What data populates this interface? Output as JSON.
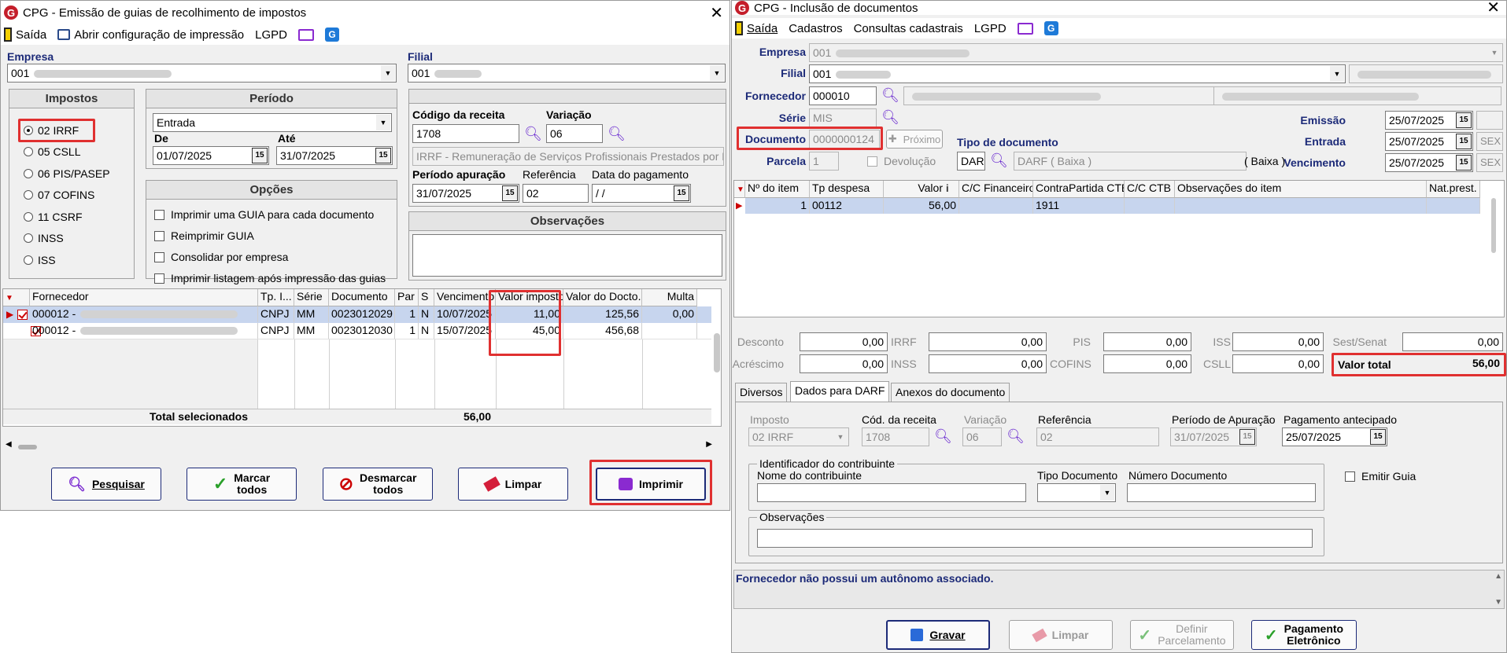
{
  "left": {
    "title": "CPG - Emissão de guias de recolhimento de impostos",
    "menu": {
      "exit": "Saída",
      "print_config": "Abrir configuração de impressão",
      "lgpd": "LGPD"
    },
    "empresa_label": "Empresa",
    "empresa_value": "001",
    "filial_label": "Filial",
    "filial_value": "001",
    "impostos": {
      "title": "Impostos",
      "options": [
        "02 IRRF",
        "05 CSLL",
        "06 PIS/PASEP",
        "07 COFINS",
        "11 CSRF",
        "INSS",
        "ISS"
      ],
      "selected": "02 IRRF"
    },
    "periodo": {
      "title": "Período",
      "tipo": "Entrada",
      "de_label": "De",
      "de": "01/07/2025",
      "ate_label": "Até",
      "ate": "31/07/2025"
    },
    "opcoes": {
      "title": "Opções",
      "items": [
        "Imprimir uma GUIA para cada documento",
        "Reimprimir GUIA",
        "Consolidar por empresa",
        "Imprimir listagem após impressão das guias"
      ]
    },
    "receita": {
      "codigo_label": "Código da receita",
      "codigo": "1708",
      "variacao_label": "Variação",
      "variacao": "06",
      "descricao": "IRRF - Remuneração de Serviços Profissionais Prestados por Pe",
      "periodo_label": "Período apuração",
      "periodo": "31/07/2025",
      "referencia_label": "Referência",
      "referencia": "02",
      "data_pag_label": "Data do pagamento",
      "data_pag": " /  /"
    },
    "observacoes_label": "Observações",
    "grid": {
      "headers": [
        "Fornecedor",
        "Tp. I...",
        "Série",
        "Documento",
        "Par",
        "S",
        "Vencimento",
        "Valor imposto",
        "Valor do Docto.",
        "Multa"
      ],
      "rows": [
        {
          "fornecedor": "000012 -",
          "tp": "CNPJ",
          "serie": "MM",
          "documento": "0023012029",
          "par": "1",
          "s": "N",
          "vencimento": "10/07/2025",
          "valor_imposto": "11,00",
          "valor_docto": "125,56",
          "multa": "0,00"
        },
        {
          "fornecedor": "000012 -",
          "tp": "CNPJ",
          "serie": "MM",
          "documento": "0023012030",
          "par": "1",
          "s": "N",
          "vencimento": "15/07/2025",
          "valor_imposto": "45,00",
          "valor_docto": "456,68",
          "multa": ""
        }
      ],
      "total_label": "Total selecionados",
      "total": "56,00"
    },
    "buttons": {
      "pesquisar": "Pesquisar",
      "marcar": "Marcar\ntodos",
      "desmarcar": "Desmarcar\ntodos",
      "limpar": "Limpar",
      "imprimir": "Imprimir"
    }
  },
  "right": {
    "title": "CPG - Inclusão de documentos",
    "menu": {
      "exit": "Saída",
      "cadastros": "Cadastros",
      "consultas": "Consultas cadastrais",
      "lgpd": "LGPD"
    },
    "empresa_label": "Empresa",
    "empresa": "001",
    "filial_label": "Filial",
    "filial": "001",
    "fornecedor_label": "Fornecedor",
    "fornecedor": "000010",
    "serie_label": "Série",
    "serie": "MIS",
    "documento_label": "Documento",
    "documento": "0000000124",
    "proximo": "Próximo",
    "tipo_doc_label": "Tipo de documento",
    "tipo_doc_code": "DAR",
    "tipo_doc_desc": "DARF ( Baixa )",
    "tipo_doc_suffix": "( Baixa )",
    "parcela_label": "Parcela",
    "parcela": "1",
    "devolucao": "Devolução",
    "emissao_label": "Emissão",
    "emissao": "25/07/2025",
    "entrada_label": "Entrada",
    "entrada": "25/07/2025",
    "entrada_day": "SEX",
    "vencimento_label": "Vencimento",
    "vencimento": "25/07/2025",
    "vencimento_day": "SEX",
    "grid": {
      "headers": [
        "Nº do item",
        "Tp despesa",
        "Valor",
        "C/C Financeiro",
        "ContraPartida CTB",
        "C/C CTB",
        "Observações do item",
        "Nat.prest."
      ],
      "rows": [
        {
          "item": "1",
          "tp": "00112",
          "valor": "56,00",
          "cc": "",
          "contra": "1911",
          "cc_ctb": "",
          "obs": "",
          "nat": ""
        }
      ]
    },
    "totals": {
      "desconto_label": "Desconto",
      "desconto": "0,00",
      "acrescimo_label": "Acréscimo",
      "acrescimo": "0,00",
      "irrf_label": "IRRF",
      "irrf": "0,00",
      "inss_label": "INSS",
      "inss": "0,00",
      "pis_label": "PIS",
      "pis": "0,00",
      "cofins_label": "COFINS",
      "cofins": "0,00",
      "iss_label": "ISS",
      "iss": "0,00",
      "csll_label": "CSLL",
      "csll": "0,00",
      "sest_label": "Sest/Senat",
      "sest": "0,00",
      "total_label": "Valor total",
      "total": "56,00"
    },
    "tabs": [
      "Diversos",
      "Dados para DARF",
      "Anexos do documento"
    ],
    "darf": {
      "imposto_label": "Imposto",
      "imposto": "02 IRRF",
      "cod_label": "Cód. da receita",
      "cod": "1708",
      "variacao_label": "Variação",
      "variacao": "06",
      "referencia_label": "Referência",
      "referencia": "02",
      "periodo_label": "Período de Apuração",
      "periodo": "31/07/2025",
      "pag_label": "Pagamento antecipado",
      "pag": "25/07/2025",
      "ident_label": "Identificador do contribuinte",
      "nome_label": "Nome do contribuinte",
      "tipo_doc_label": "Tipo Documento",
      "num_doc_label": "Número Documento",
      "emitir_guia": "Emitir Guia",
      "obs_label": "Observações"
    },
    "message": "Fornecedor não possui um autônomo associado.",
    "buttons": {
      "gravar": "Gravar",
      "limpar": "Limpar",
      "definir": "Definir\nParcelamento",
      "pagamento": "Pagamento\nEletrônico"
    }
  }
}
